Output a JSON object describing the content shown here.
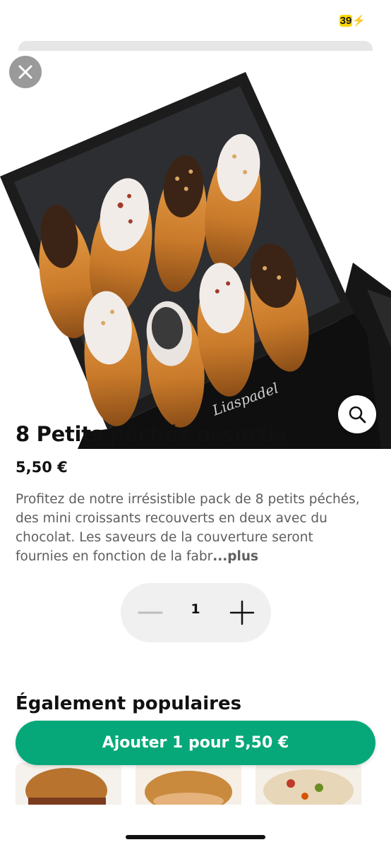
{
  "status": {
    "battery": "39"
  },
  "product": {
    "name": "8 Petits péchés assortis",
    "price": "5,50 €",
    "description": "Profitez de notre irrésistible pack de 8 petits péchés, des mini croissants recouverts en deux avec du chocolat. Les saveurs de la couverture seront fournies en fonction de la fabr",
    "more_label": "...plus",
    "box_brand": "Liaspadel"
  },
  "quantity": {
    "value": "1"
  },
  "section": {
    "title": "Également populaires"
  },
  "cta": {
    "label": "Ajouter 1 pour 5,50 €"
  },
  "colors": {
    "accent": "#06a879",
    "battery": "#ffd60a"
  },
  "icons": [
    "close-icon",
    "zoom-icon",
    "minus-icon",
    "plus-icon",
    "charging-bolt-icon"
  ]
}
